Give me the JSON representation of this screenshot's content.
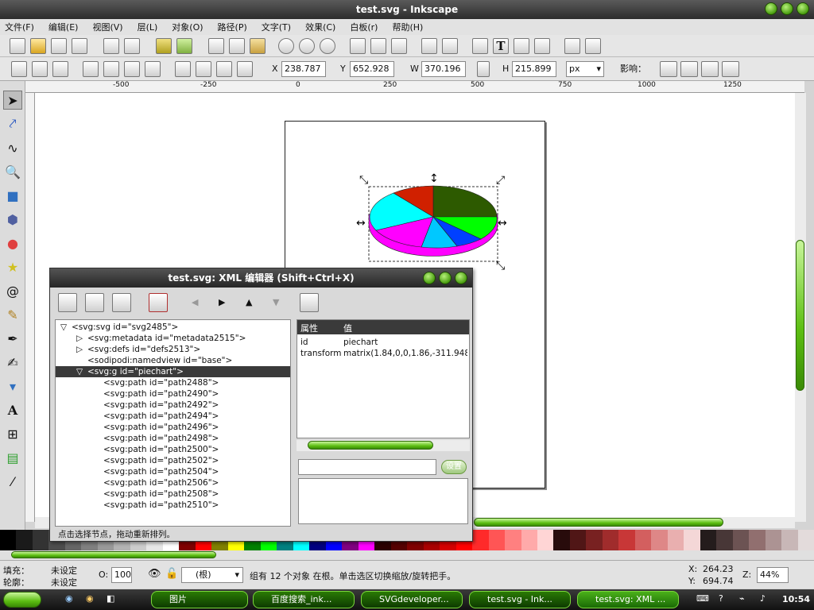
{
  "window": {
    "title": "test.svg - Inkscape"
  },
  "menu": [
    "文件(F)",
    "编辑(E)",
    "视图(V)",
    "层(L)",
    "对象(O)",
    "路径(P)",
    "文字(T)",
    "效果(C)",
    "白板(r)",
    "帮助(H)"
  ],
  "coords": {
    "x_label": "X",
    "x_value": "238.787",
    "y_label": "Y",
    "y_value": "652.928",
    "w_label": "W",
    "w_value": "370.196",
    "h_label": "H",
    "h_value": "215.899",
    "unit": "px",
    "affect_label": "影响："
  },
  "ruler": {
    "marks": [
      "-500",
      "-250",
      "0",
      "250",
      "500",
      "750",
      "1000",
      "1250"
    ]
  },
  "xml_editor": {
    "title": "test.svg: XML 编辑器 (Shift+Ctrl+X)",
    "toolbar_icons": [
      "new-element-node-icon",
      "new-text-node-icon",
      "duplicate-node-icon",
      "delete-node-icon",
      "unindent-icon",
      "indent-icon",
      "raise-icon",
      "lower-icon",
      "set-attribute-icon"
    ],
    "tree": [
      {
        "text": "<svg:svg id=\"svg2485\">",
        "indent": 0,
        "expander": "open"
      },
      {
        "text": "<svg:metadata id=\"metadata2515\">",
        "indent": 1,
        "expander": "closed"
      },
      {
        "text": "<svg:defs id=\"defs2513\">",
        "indent": 1,
        "expander": "closed"
      },
      {
        "text": "<sodipodi:namedview id=\"base\">",
        "indent": 1,
        "expander": "none"
      },
      {
        "text": "<svg:g id=\"piechart\">",
        "indent": 1,
        "expander": "open",
        "selected": true
      },
      {
        "text": "<svg:path id=\"path2488\">",
        "indent": 2,
        "expander": "none"
      },
      {
        "text": "<svg:path id=\"path2490\">",
        "indent": 2,
        "expander": "none"
      },
      {
        "text": "<svg:path id=\"path2492\">",
        "indent": 2,
        "expander": "none"
      },
      {
        "text": "<svg:path id=\"path2494\">",
        "indent": 2,
        "expander": "none"
      },
      {
        "text": "<svg:path id=\"path2496\">",
        "indent": 2,
        "expander": "none"
      },
      {
        "text": "<svg:path id=\"path2498\">",
        "indent": 2,
        "expander": "none"
      },
      {
        "text": "<svg:path id=\"path2500\">",
        "indent": 2,
        "expander": "none"
      },
      {
        "text": "<svg:path id=\"path2502\">",
        "indent": 2,
        "expander": "none"
      },
      {
        "text": "<svg:path id=\"path2504\">",
        "indent": 2,
        "expander": "none"
      },
      {
        "text": "<svg:path id=\"path2506\">",
        "indent": 2,
        "expander": "none"
      },
      {
        "text": "<svg:path id=\"path2508\">",
        "indent": 2,
        "expander": "none"
      },
      {
        "text": "<svg:path id=\"path2510\">",
        "indent": 2,
        "expander": "none"
      }
    ],
    "attr_headers": {
      "name": "属性",
      "value": "值"
    },
    "attributes": [
      {
        "name": "id",
        "value": "piechart"
      },
      {
        "name": "transform",
        "value": "matrix(1.84,0,0,1.86,-311.948,-"
      }
    ],
    "set_button": "设置",
    "attr_name_input": "",
    "attr_value_input": "",
    "status": "点击选择节点，拖动重新排列。"
  },
  "status": {
    "fill_label": "填充：",
    "fill_value": "未设定",
    "stroke_label": "轮廓：",
    "stroke_value": "未设定",
    "opacity_label": "O:",
    "opacity_value": "100",
    "layer_value": "(根)",
    "message": "组有 12 个对象 在根。单击选区切换缩放/旋转把手。",
    "cursor_x_label": "X:",
    "cursor_x": "264.23",
    "cursor_y_label": "Y:",
    "cursor_y": "694.74",
    "zoom_label": "Z:",
    "zoom_value": "44%"
  },
  "palette": [
    "#000000",
    "#1a1a1a",
    "#333333",
    "#4d4d4d",
    "#666666",
    "#808080",
    "#999999",
    "#b3b3b3",
    "#cccccc",
    "#e6e6e6",
    "#ffffff",
    "#800000",
    "#ff0000",
    "#808000",
    "#ffff00",
    "#008000",
    "#00ff00",
    "#008080",
    "#00ffff",
    "#000080",
    "#0000ff",
    "#800080",
    "#ff00ff",
    "#2b0000",
    "#550000",
    "#800000",
    "#aa0000",
    "#d40000",
    "#ff0000",
    "#ff2a2a",
    "#ff5555",
    "#ff8080",
    "#ffaaaa",
    "#ffd5d5",
    "#280b0b",
    "#501616",
    "#782121",
    "#a02c2c",
    "#c83737",
    "#d35f5f",
    "#de8787",
    "#e9afaf",
    "#f4d7d7",
    "#241c1c",
    "#483737",
    "#6c5353",
    "#916f6f",
    "#ac9393",
    "#c8b7b7",
    "#e3dbdb"
  ],
  "pie_colors": [
    "#2d5a00",
    "#00ff00",
    "#0040ff",
    "#00c8ff",
    "#ff00ff",
    "#00ffff",
    "#d02000"
  ],
  "taskbar": {
    "items": [
      "图片",
      "百度搜索_ink...",
      "SVGdeveloper...",
      "test.svg - Ink...",
      "test.svg: XML ..."
    ],
    "clock": "10:54"
  }
}
